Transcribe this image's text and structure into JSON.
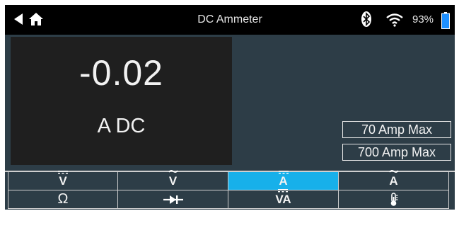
{
  "header": {
    "title": "DC Ammeter",
    "battery_percent": "93%",
    "icons": [
      "back-arrow-icon",
      "home-icon",
      "bluetooth-icon",
      "wifi-icon",
      "battery-icon"
    ]
  },
  "reading": {
    "value": "-0.02",
    "unit": "A DC"
  },
  "ranges": {
    "r70": "70 Amp Max",
    "r700": "700 Amp Max"
  },
  "modes": {
    "dc_volts": "V",
    "ac_volts": "V",
    "dc_amps": "A",
    "ac_amps": "A",
    "ohms": "Ω",
    "dc_va": "VA",
    "active": "dc_amps"
  },
  "colors": {
    "header_bg": "#000000",
    "screen_bg": "#2d3d47",
    "reading_bg": "#1f1f1f",
    "active_accent": "#17b0ea"
  }
}
